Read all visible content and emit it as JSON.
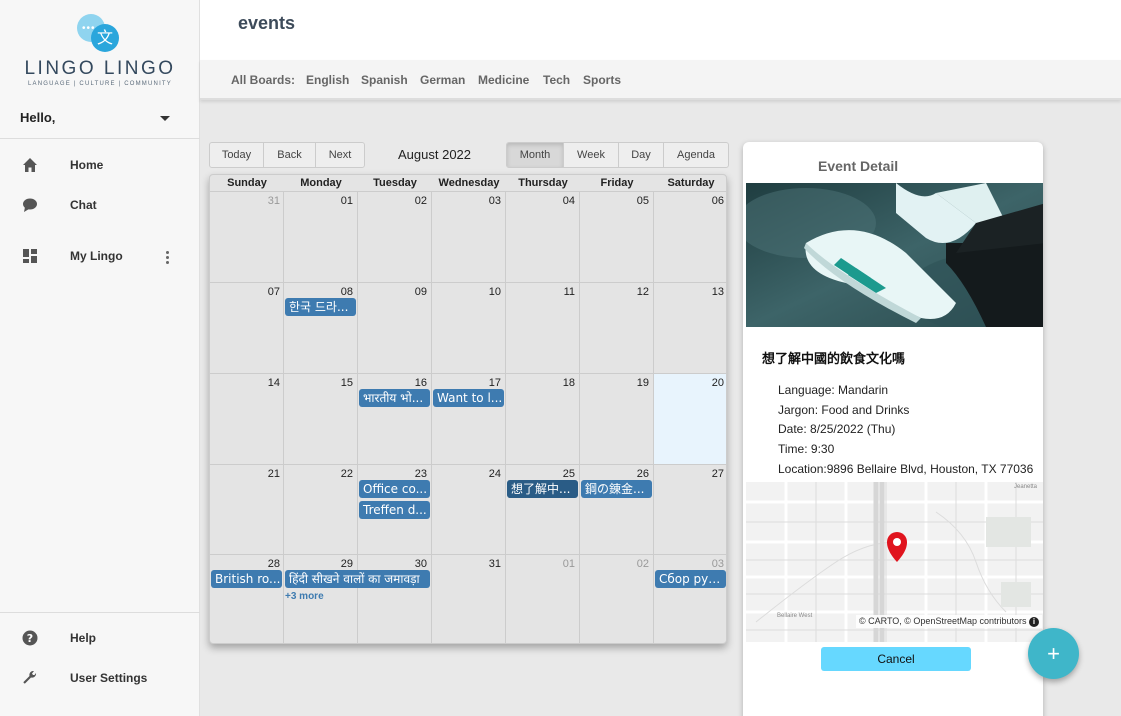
{
  "app": {
    "brand": "LINGO LINGO",
    "tagline": "LANGUAGE | CULTURE | COMMUNITY",
    "logo_glyph": "文"
  },
  "sidebar": {
    "greeting": "Hello,",
    "items": [
      {
        "label": "Home",
        "icon": "home-icon"
      },
      {
        "label": "Chat",
        "icon": "chat-icon"
      },
      {
        "label": "My Lingo",
        "icon": "dashboard-icon"
      }
    ],
    "bottom_items": [
      {
        "label": "Help",
        "icon": "help-icon"
      },
      {
        "label": "User Settings",
        "icon": "wrench-icon"
      }
    ]
  },
  "header": {
    "title": "events",
    "boards": [
      "All Boards:",
      "English",
      "Spanish",
      "German",
      "Medicine",
      "Tech",
      "Sports"
    ]
  },
  "calendar": {
    "nav": [
      "Today",
      "Back",
      "Next"
    ],
    "month_label": "August 2022",
    "views": [
      "Month",
      "Week",
      "Day",
      "Agenda"
    ],
    "active_view": "Month",
    "weekdays": [
      "Sunday",
      "Monday",
      "Tuesday",
      "Wednesday",
      "Thursday",
      "Friday",
      "Saturday"
    ],
    "weeks": [
      [
        "31",
        "01",
        "02",
        "03",
        "04",
        "05",
        "06"
      ],
      [
        "07",
        "08",
        "09",
        "10",
        "11",
        "12",
        "13"
      ],
      [
        "14",
        "15",
        "16",
        "17",
        "18",
        "19",
        "20"
      ],
      [
        "21",
        "22",
        "23",
        "24",
        "25",
        "26",
        "27"
      ],
      [
        "28",
        "29",
        "30",
        "31",
        "01",
        "02",
        "03"
      ]
    ],
    "events": [
      {
        "label": "한국 드라..."
      },
      {
        "label": "भारतीय भो..."
      },
      {
        "label": "Want to l..."
      },
      {
        "label": "Office co..."
      },
      {
        "label": "Treffen d..."
      },
      {
        "label": "想了解中..."
      },
      {
        "label": "鋼の錬金..."
      },
      {
        "label": "British ro..."
      },
      {
        "label": "हिंदी सीखने वालों का जमावड़ा"
      },
      {
        "label": "Сбор рус..."
      }
    ],
    "more_label": "+3 more"
  },
  "event_detail": {
    "heading": "Event Detail",
    "name": "想了解中國的飲食文化嗎",
    "language": "Language: Mandarin",
    "jargon": "Jargon: Food and Drinks",
    "date": "Date: 8/25/2022 (Thu)",
    "time": "Time: 9:30",
    "location": "Location:9896 Bellaire Blvd, Houston, TX 77036",
    "map_attribution": "© CARTO, © OpenStreetMap contributors",
    "map_labels": [
      "Jeanetta",
      "Bellaire West"
    ],
    "cancel_label": "Cancel"
  },
  "fab_label": "+"
}
